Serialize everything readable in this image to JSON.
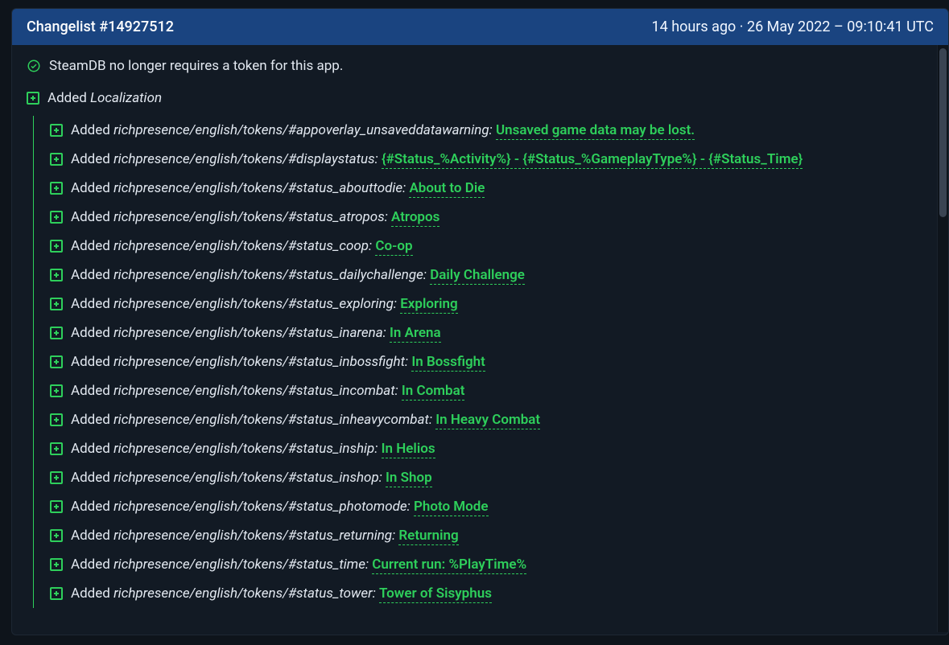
{
  "header": {
    "title": "Changelist #14927512",
    "time_rel": "14 hours ago",
    "sep": " · ",
    "time_abs": "26 May 2022 – 09:10:41 UTC"
  },
  "colors": {
    "accent": "#2ecf5b",
    "header_bg": "#1a4480",
    "text": "#e2e8f0"
  },
  "note": "SteamDB no longer requires a token for this app.",
  "added_label": "Added",
  "root_key": "Localization",
  "entries": [
    {
      "key": "richpresence/english/tokens/#appoverlay_unsaveddatawarning:",
      "value": "Unsaved game data may be lost."
    },
    {
      "key": "richpresence/english/tokens/#displaystatus:",
      "value": "{#Status_%Activity%} - {#Status_%GameplayType%} - {#Status_Time}"
    },
    {
      "key": "richpresence/english/tokens/#status_abouttodie:",
      "value": "About to Die"
    },
    {
      "key": "richpresence/english/tokens/#status_atropos:",
      "value": "Atropos"
    },
    {
      "key": "richpresence/english/tokens/#status_coop:",
      "value": "Co-op"
    },
    {
      "key": "richpresence/english/tokens/#status_dailychallenge:",
      "value": "Daily Challenge"
    },
    {
      "key": "richpresence/english/tokens/#status_exploring:",
      "value": "Exploring"
    },
    {
      "key": "richpresence/english/tokens/#status_inarena:",
      "value": "In Arena"
    },
    {
      "key": "richpresence/english/tokens/#status_inbossfight:",
      "value": "In Bossfight"
    },
    {
      "key": "richpresence/english/tokens/#status_incombat:",
      "value": "In Combat"
    },
    {
      "key": "richpresence/english/tokens/#status_inheavycombat:",
      "value": "In Heavy Combat"
    },
    {
      "key": "richpresence/english/tokens/#status_inship:",
      "value": "In Helios"
    },
    {
      "key": "richpresence/english/tokens/#status_inshop:",
      "value": "In Shop"
    },
    {
      "key": "richpresence/english/tokens/#status_photomode:",
      "value": "Photo Mode"
    },
    {
      "key": "richpresence/english/tokens/#status_returning:",
      "value": "Returning"
    },
    {
      "key": "richpresence/english/tokens/#status_time:",
      "value": "Current run: %PlayTime%"
    },
    {
      "key": "richpresence/english/tokens/#status_tower:",
      "value": "Tower of Sisyphus"
    }
  ]
}
